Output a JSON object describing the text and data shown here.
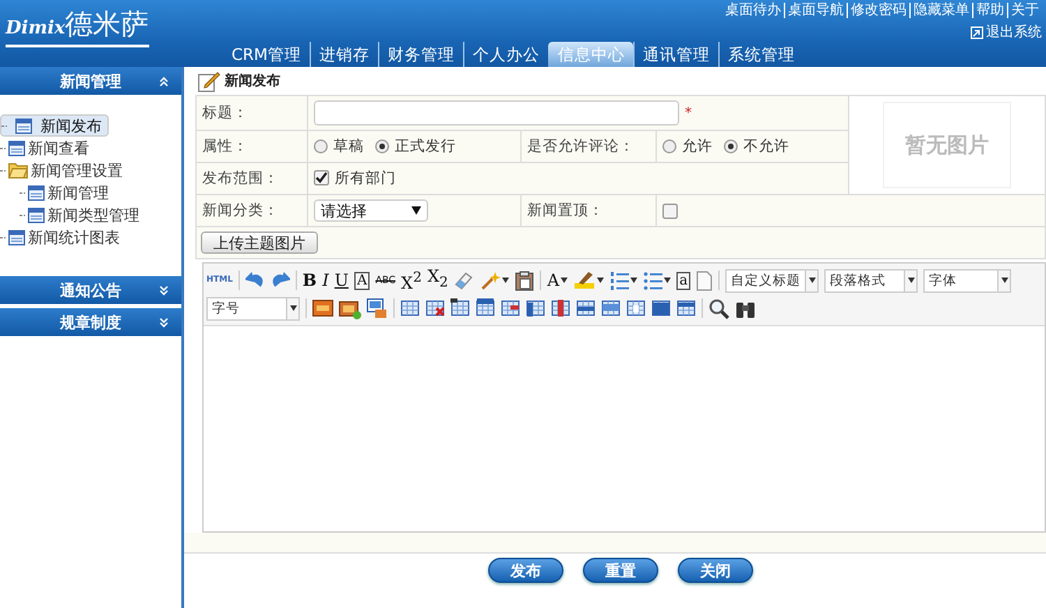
{
  "header": {
    "logo_latin": "Dimix",
    "logo_cjk": "德米萨",
    "top_links": [
      "桌面待办",
      "桌面导航",
      "修改密码",
      "隐藏菜单",
      "帮助",
      "关于"
    ],
    "logout": "退出系统",
    "nav_tabs": [
      {
        "label": "CRM管理",
        "selected": false
      },
      {
        "label": "进销存",
        "selected": false
      },
      {
        "label": "财务管理",
        "selected": false
      },
      {
        "label": "个人办公",
        "selected": false
      },
      {
        "label": "信息中心",
        "selected": true
      },
      {
        "label": "通讯管理",
        "selected": false
      },
      {
        "label": "系统管理",
        "selected": false
      }
    ]
  },
  "sidebar": {
    "sections": [
      {
        "title": "新闻管理",
        "expanded": true,
        "tree": [
          {
            "label": "新闻发布",
            "selected": true
          },
          {
            "label": "新闻查看",
            "selected": false
          },
          {
            "label": "新闻管理设置",
            "selected": false,
            "expanded": true,
            "children": [
              {
                "label": "新闻管理",
                "selected": false
              },
              {
                "label": "新闻类型管理",
                "selected": false
              }
            ]
          },
          {
            "label": "新闻统计图表",
            "selected": false
          }
        ]
      },
      {
        "title": "通知公告",
        "expanded": false
      },
      {
        "title": "规章制度",
        "expanded": false
      }
    ]
  },
  "page_title": "新闻发布",
  "form": {
    "title_label": "标题：",
    "title_required_mark": "*",
    "property_label": "属性：",
    "property_options": [
      {
        "label": "草稿",
        "selected": false
      },
      {
        "label": "正式发行",
        "selected": true
      }
    ],
    "comment_label": "是否允许评论：",
    "comment_options": [
      {
        "label": "允许",
        "selected": false
      },
      {
        "label": "不允许",
        "selected": true
      }
    ],
    "scope_label": "发布范围：",
    "scope_checkbox": {
      "label": "所有部门",
      "checked": true
    },
    "category_label": "新闻分类：",
    "category_value": "请选择",
    "pin_label": "新闻置顶：",
    "pin_checked": false,
    "image_placeholder": "暂无图片",
    "upload_button": "上传主题图片"
  },
  "editor": {
    "toolbar_rows": [
      [
        {
          "kind": "html",
          "label": "HTML"
        },
        {
          "kind": "separator"
        },
        {
          "kind": "icon"
        },
        {
          "kind": "icon"
        },
        {
          "kind": "separator"
        },
        {
          "kind": "bold",
          "label": "B"
        },
        {
          "kind": "italic",
          "label": "I"
        },
        {
          "kind": "underline",
          "label": "U"
        },
        {
          "kind": "boxed",
          "label": "A"
        },
        {
          "kind": "strike",
          "label": "ABC"
        },
        {
          "kind": "glyph",
          "label": "X$^{2}$"
        },
        {
          "kind": "glyph",
          "label": "X$_{2}$"
        },
        {
          "kind": "icon"
        },
        {
          "kind": "icon",
          "dropdown": true
        },
        {
          "kind": "icon"
        },
        {
          "kind": "separator"
        },
        {
          "kind": "glyph",
          "label": "A",
          "dropdown": true
        },
        {
          "kind": "icon",
          "dropdown": true
        },
        {
          "kind": "icon",
          "dropdown": true
        },
        {
          "kind": "icon",
          "dropdown": true
        },
        {
          "kind": "boxed",
          "label": "a"
        },
        {
          "kind": "icon"
        },
        {
          "kind": "separator"
        },
        {
          "kind": "select",
          "label": "自定义标题"
        },
        {
          "kind": "select",
          "label": "段落格式"
        },
        {
          "kind": "select",
          "label": "字体"
        }
      ],
      [
        {
          "kind": "select",
          "label": "字号"
        },
        {
          "kind": "separator"
        },
        {
          "kind": "icon"
        },
        {
          "kind": "icon"
        },
        {
          "kind": "icon"
        },
        {
          "kind": "separator"
        },
        {
          "kind": "icon"
        },
        {
          "kind": "icon"
        },
        {
          "kind": "icon"
        },
        {
          "kind": "icon"
        },
        {
          "kind": "icon"
        },
        {
          "kind": "icon"
        },
        {
          "kind": "icon"
        },
        {
          "kind": "icon"
        },
        {
          "kind": "icon"
        },
        {
          "kind": "icon"
        },
        {
          "kind": "icon"
        },
        {
          "kind": "icon"
        },
        {
          "kind": "separator"
        },
        {
          "kind": "icon"
        },
        {
          "kind": "icon"
        }
      ]
    ]
  },
  "actions": [
    "发布",
    "重置",
    "关闭"
  ]
}
